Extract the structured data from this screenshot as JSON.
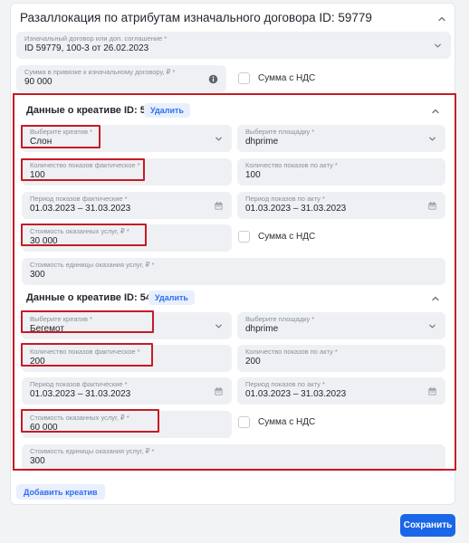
{
  "header": {
    "title": "Разаллокация по атрибутам изначального договора ID: 59779"
  },
  "contract": {
    "label": "Изначальный договор или доп. соглашение *",
    "value": "ID 59779, 100-3 от 26.02.2023"
  },
  "amount": {
    "label": "Сумма в привязке к изначальному договору, ₽ *",
    "value": "90 000"
  },
  "vat_label": "Сумма с НДС",
  "creatives": [
    {
      "title": "Данные о креативе ID: 5353",
      "delete_label": "Удалить",
      "creative_field": {
        "label": "Выберите креатив *",
        "value": "Слон"
      },
      "platform_field": {
        "label": "Выберите площадку *",
        "value": "dhprime"
      },
      "actual_shows": {
        "label": "Количество показов фактическое *",
        "value": "100"
      },
      "act_shows": {
        "label": "Количество показов по акту *",
        "value": "100"
      },
      "actual_period": {
        "label": "Период показов фактические *",
        "value": "01.03.2023 – 31.03.2023"
      },
      "act_period": {
        "label": "Период показов по акту *",
        "value": "01.03.2023 – 31.03.2023"
      },
      "cost": {
        "label": "Стоимость оказанных услуг, ₽ *",
        "value": "30 000"
      },
      "unit_cost": {
        "label": "Стоимость единицы оказания услуг, ₽ *",
        "value": "300"
      }
    },
    {
      "title": "Данные о креативе ID: 5410",
      "delete_label": "Удалить",
      "creative_field": {
        "label": "Выберите креатив *",
        "value": "Бегемот"
      },
      "platform_field": {
        "label": "Выберите площадку *",
        "value": "dhprime"
      },
      "actual_shows": {
        "label": "Количество показов фактическое *",
        "value": "200"
      },
      "act_shows": {
        "label": "Количество показов по акту *",
        "value": "200"
      },
      "actual_period": {
        "label": "Период показов фактические *",
        "value": "01.03.2023 – 31.03.2023"
      },
      "act_period": {
        "label": "Период показов по акту *",
        "value": "01.03.2023 – 31.03.2023"
      },
      "cost": {
        "label": "Стоимость оказанных услуг, ₽ *",
        "value": "60 000"
      },
      "unit_cost": {
        "label": "Стоимость единицы оказания услуг, ₽ *",
        "value": "300"
      }
    }
  ],
  "buttons": {
    "add_creative": "Добавить креатив",
    "save": "Сохранить"
  },
  "icons": {
    "chevron_up": "chevron-up-icon",
    "chevron_down": "chevron-down-icon",
    "info": "info-icon",
    "calendar": "calendar-icon"
  },
  "colors": {
    "accent": "#1a66e8",
    "highlight": "#c61b26",
    "field_bg": "#eef0f3"
  }
}
